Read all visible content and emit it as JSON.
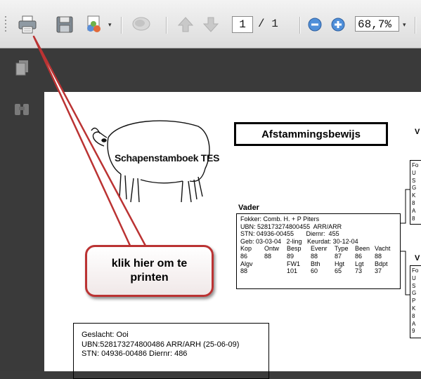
{
  "toolbar": {
    "page_current": "1",
    "page_total": "/ 1",
    "zoom": "68,7%"
  },
  "document": {
    "title": "Afstammingsbewijs",
    "logo_text": "Schapenstamboek TES",
    "vader": {
      "label": "Vader",
      "lines": [
        "Fokker: Comb. H. + P Piters",
        "UBN: 528173274800455  ARR/ARR",
        "STN: 04936-00455       Diernr:  455",
        "Geb: 03-03-04   2-ling   Keurdat: 30-12-04"
      ],
      "grid_header1": [
        "Kop",
        "Ontw",
        "Besp",
        "Evenr",
        "Type",
        "Been",
        "Vacht"
      ],
      "grid_values1": [
        "86",
        "88",
        "89",
        "88",
        "87",
        "86",
        "88"
      ],
      "grid_header2": [
        "Algv",
        "",
        "FW1",
        "Bth",
        "Hgt",
        "Lgt",
        "Bdpt"
      ],
      "grid_values2": [
        "88",
        "",
        "101",
        "60",
        "65",
        "73",
        "37"
      ]
    },
    "right_v_top": {
      "label": "V",
      "lines": [
        "Fo",
        "U",
        "S",
        "G",
        "K",
        "8",
        "A",
        "8"
      ]
    },
    "right_v_bottom": {
      "label": "V",
      "lines": [
        "Fo",
        "U",
        "S",
        "G",
        "P",
        "K",
        "8",
        "A",
        "9"
      ]
    },
    "animal": {
      "lines": [
        "Geslacht: Ooi",
        "UBN:528173274800486 ARR/ARH (25-06-09)",
        "STN: 04936-00486        Diernr:  486"
      ]
    }
  },
  "callout": {
    "line1": "klik hier om te",
    "line2": "printen"
  }
}
